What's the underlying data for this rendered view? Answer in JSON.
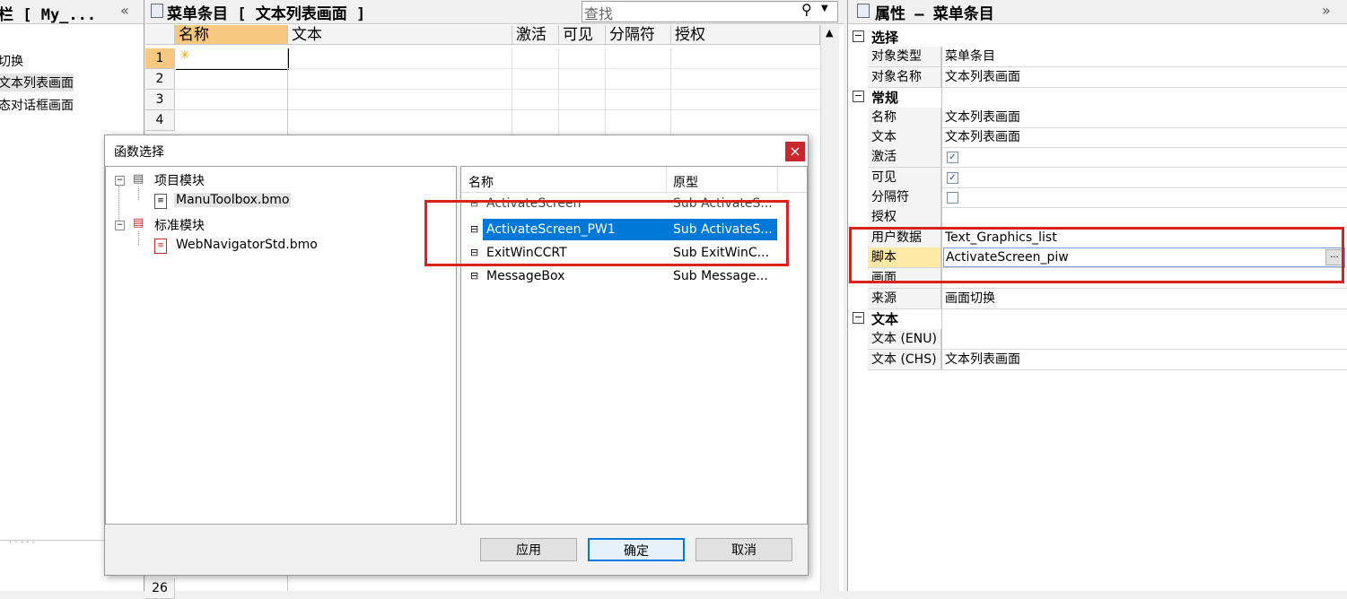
{
  "left_panel": {
    "title": "栏 [ My_...",
    "collapse_icon": "«",
    "items": [
      "切换",
      "文本列表画面",
      "态对话框画面"
    ]
  },
  "grid_panel": {
    "title": "菜单条目 [ 文本列表画面 ]",
    "search_placeholder": "查找",
    "columns": [
      "名称",
      "文本",
      "激活",
      "可见",
      "分隔符",
      "授权"
    ],
    "row_numbers": [
      "1",
      "2",
      "3",
      "4"
    ],
    "bottom_row_number": "26"
  },
  "properties": {
    "title": "属性 – 菜单条目",
    "expand_icon": "»",
    "sections": {
      "select": {
        "label": "选择",
        "rows": [
          {
            "name": "对象类型",
            "value": "菜单条目"
          },
          {
            "name": "对象名称",
            "value": "文本列表画面"
          }
        ]
      },
      "general": {
        "label": "常规",
        "rows": [
          {
            "name": "名称",
            "value": "文本列表画面"
          },
          {
            "name": "文本",
            "value": "文本列表画面"
          },
          {
            "name": "激活",
            "value": ""
          },
          {
            "name": "可见",
            "value": ""
          },
          {
            "name": "分隔符",
            "value": ""
          },
          {
            "name": "授权",
            "value": ""
          },
          {
            "name": "用户数据",
            "value": "Text_Graphics_list"
          },
          {
            "name": "脚本",
            "value": "ActivateScreen_piw"
          },
          {
            "name": "画面",
            "value": ""
          },
          {
            "name": "来源",
            "value": "画面切换"
          }
        ]
      },
      "text": {
        "label": "文本",
        "rows": [
          {
            "name": "文本 (ENU)",
            "value": ""
          },
          {
            "name": "文本 (CHS)",
            "value": "文本列表画面"
          }
        ]
      }
    },
    "ellipsis_label": "..."
  },
  "dialog": {
    "title": "函数选择",
    "close_label": "×",
    "tree": [
      {
        "label": "项目模块",
        "child": "ManuToolbox.bmo"
      },
      {
        "label": "标准模块",
        "child": "WebNavigatorStd.bmo"
      }
    ],
    "list_headers": {
      "name": "名称",
      "prototype": "原型"
    },
    "list_rows": [
      {
        "name": "ActivateScreen",
        "prototype": "Sub ActivateS..."
      },
      {
        "name": "ActivateScreen_PW1",
        "prototype": "Sub ActivateS..."
      },
      {
        "name": "ExitWinCCRT",
        "prototype": "Sub ExitWinC..."
      },
      {
        "name": "MessageBox",
        "prototype": "Sub Message..."
      }
    ],
    "selected_index": 1,
    "buttons": {
      "apply": "应用",
      "ok": "确定",
      "cancel": "取消"
    }
  },
  "colors": {
    "selection": "#0078d7",
    "highlight_box": "#d9221c",
    "script_row_bg": "#fde8a6",
    "column_active": "#f8c880"
  }
}
